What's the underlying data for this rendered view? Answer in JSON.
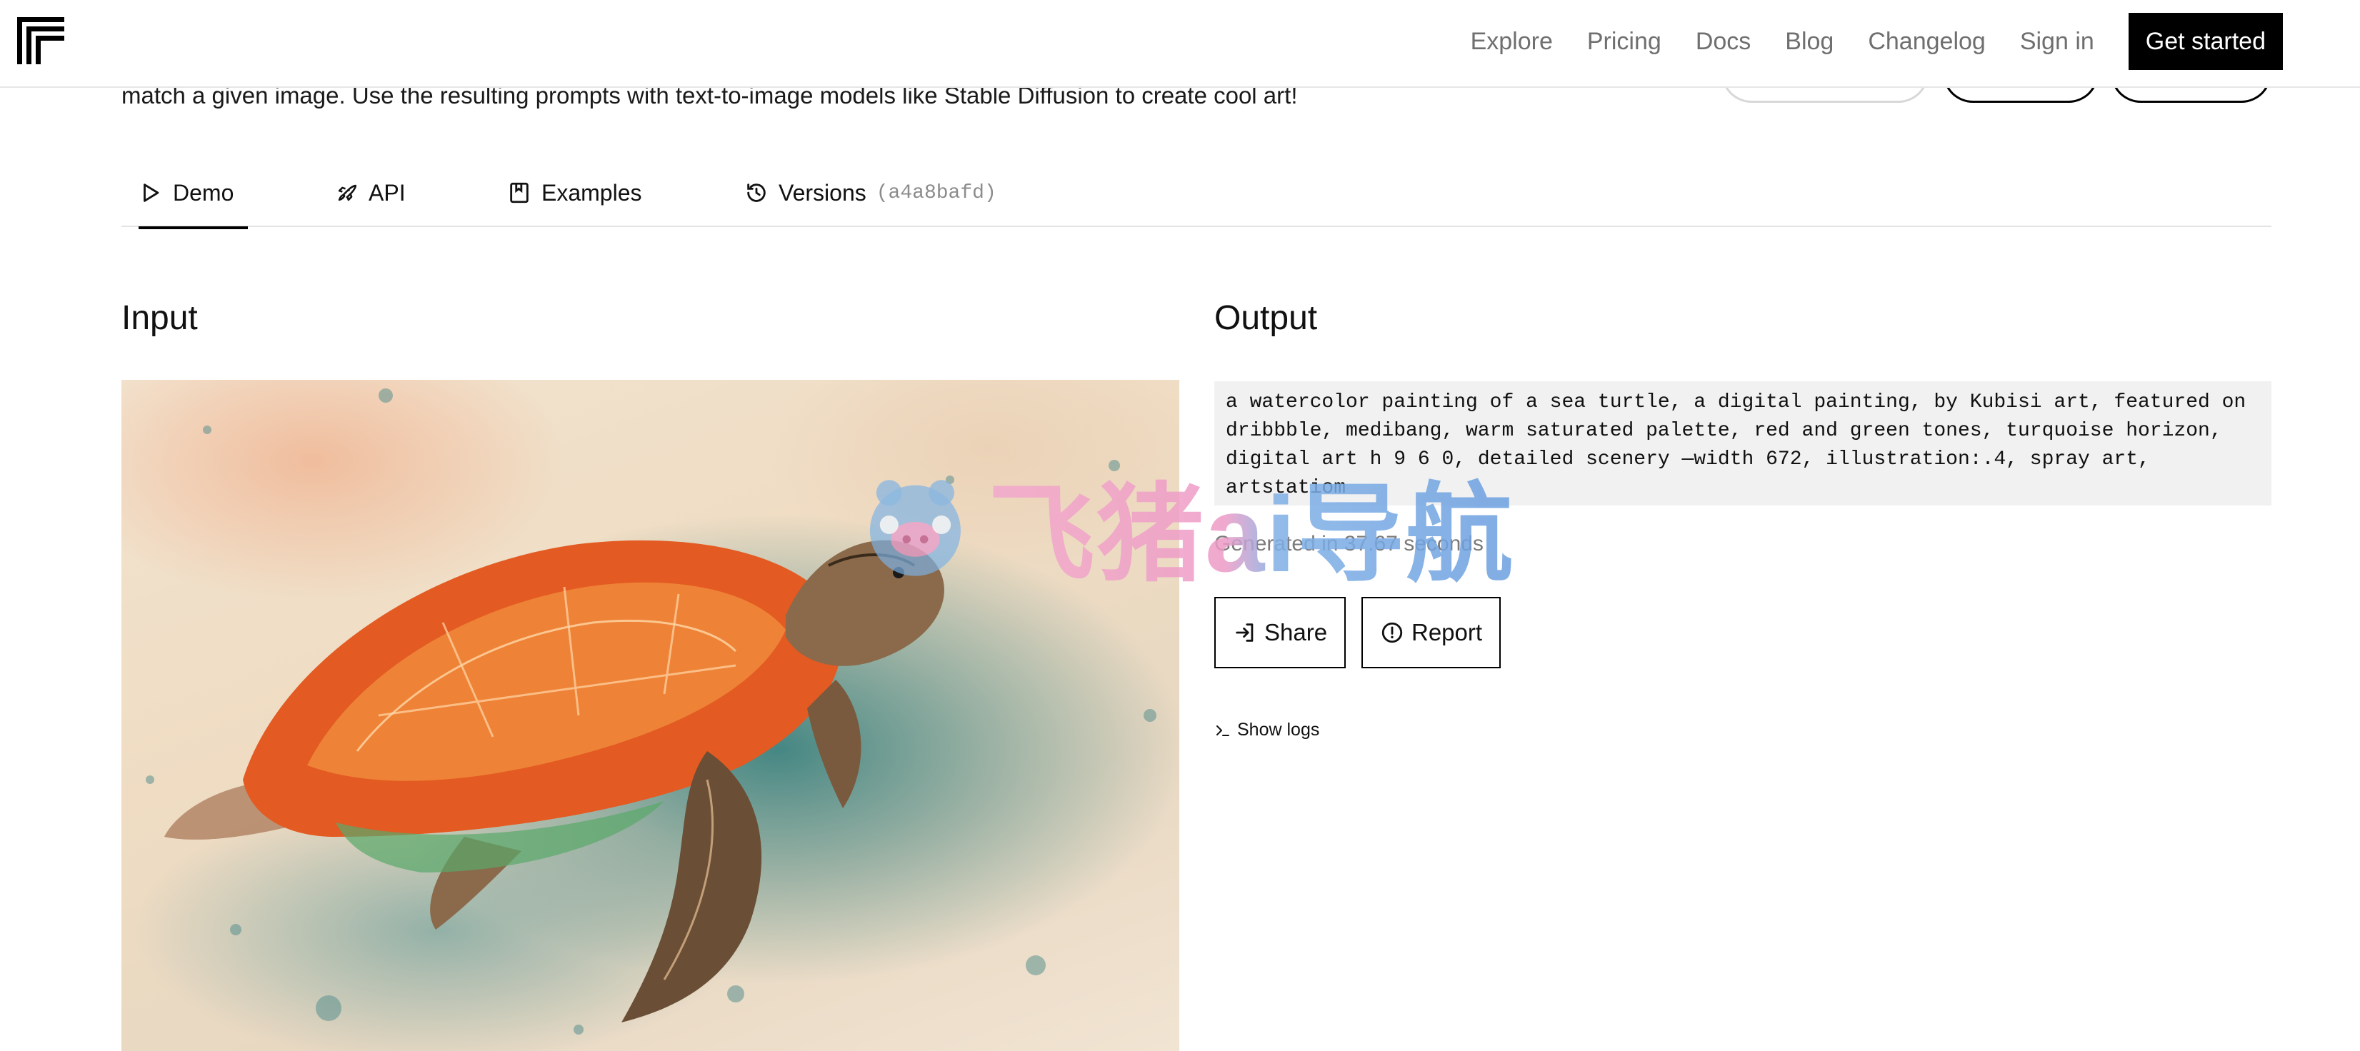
{
  "nav": {
    "links": [
      "Explore",
      "Pricing",
      "Docs",
      "Blog",
      "Changelog",
      "Sign in"
    ],
    "cta_label": "Get started"
  },
  "description_text": "match a given image. Use the resulting prompts with text-to-image models like Stable Diffusion to create cool art!",
  "tabs": [
    {
      "label": "Demo",
      "icon": "play-icon",
      "active": true
    },
    {
      "label": "API",
      "icon": "rocket-icon",
      "active": false
    },
    {
      "label": "Examples",
      "icon": "bookmark-icon",
      "active": false
    },
    {
      "label": "Versions",
      "icon": "history-icon",
      "active": false,
      "version_id": "(a4a8bafd)"
    }
  ],
  "input": {
    "title": "Input",
    "image_subject": "watercolor sea turtle painting"
  },
  "output": {
    "title": "Output",
    "prompt_text": "a watercolor painting of a sea turtle, a digital painting, by Kubisi art, featured on dribbble, medibang, warm saturated palette, red and green tones, turquoise horizon, digital art h 9 6 0, detailed scenery —width 672, illustration:.4, spray art, artstatiom",
    "generated_time": "Generated in 37.67 seconds",
    "share_label": "Share",
    "report_label": "Report",
    "show_logs_label": "Show logs"
  },
  "watermark": {
    "text": "飞猪ai导航",
    "icon": "pig-mascot-icon"
  },
  "colors": {
    "accent": "#000000",
    "muted_text": "#6f6f6f",
    "output_bg": "#f1f1f1"
  }
}
